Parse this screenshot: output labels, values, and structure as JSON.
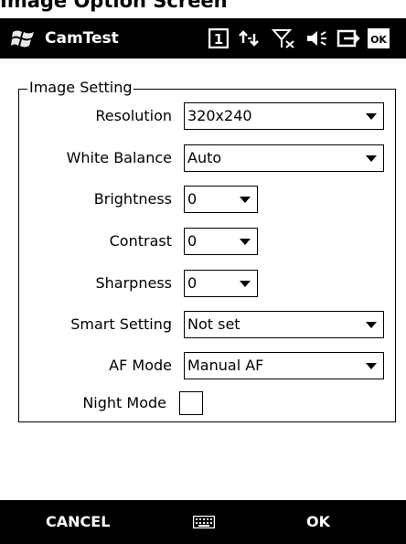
{
  "caption": "Image Option Screen",
  "titlebar": {
    "app_title": "CamTest",
    "icons": [
      "windows-start-logo",
      "sim-card-icon",
      "data-connection-icon",
      "no-signal-icon",
      "volume-muted-icon",
      "sync-icon",
      "ok-icon"
    ],
    "ok_label": "OK",
    "sim_label": "1"
  },
  "group": {
    "title": "Image Setting",
    "rows": [
      {
        "label": "Resolution",
        "value": "320x240"
      },
      {
        "label": "White Balance",
        "value": "Auto"
      },
      {
        "label": "Brightness",
        "value": "0"
      },
      {
        "label": "Contrast",
        "value": "0"
      },
      {
        "label": "Sharpness",
        "value": "0"
      },
      {
        "label": "Smart Setting",
        "value": "Not set"
      },
      {
        "label": "AF Mode",
        "value": "Manual AF"
      }
    ],
    "night_mode": {
      "label": "Night Mode",
      "checked": false
    }
  },
  "softkeys": {
    "left": "CANCEL",
    "center_icon": "keyboard-icon",
    "right": "OK"
  },
  "colors": {
    "bar_bg": "#000000",
    "bar_fg": "#ffffff",
    "page_bg": "#ffffff"
  }
}
